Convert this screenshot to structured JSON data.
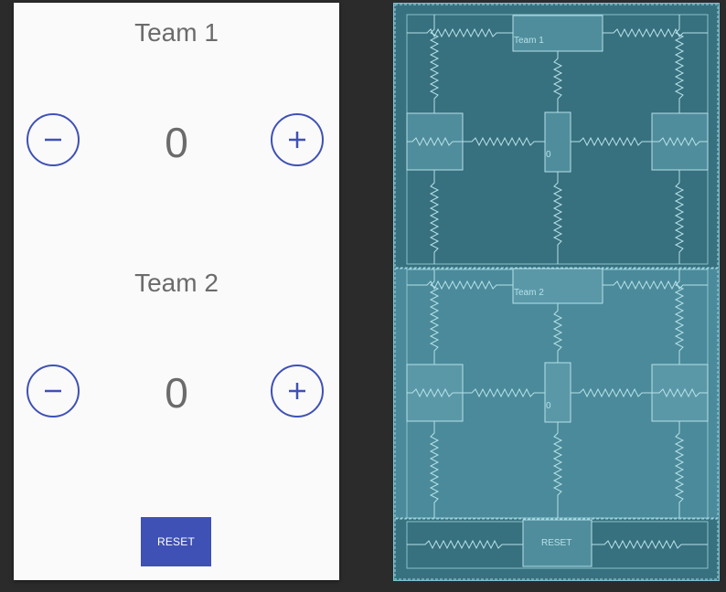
{
  "design": {
    "team1": {
      "title": "Team 1",
      "score": "0",
      "minus_label": "−",
      "plus_label": "+"
    },
    "team2": {
      "title": "Team 2",
      "score": "0",
      "minus_label": "−",
      "plus_label": "+"
    },
    "reset_label": "RESET"
  },
  "blueprint": {
    "team1_label": "Team 1",
    "team1_score": "0",
    "team2_label": "Team 2",
    "team2_score": "0",
    "reset_label": "RESET"
  },
  "colors": {
    "accent": "#3f51b5",
    "text_gray": "#6b6b6b",
    "canvas_bg": "#2b2b2b",
    "blueprint_bg": "#3d7f8f",
    "blueprint_line": "#a9d8e2"
  }
}
